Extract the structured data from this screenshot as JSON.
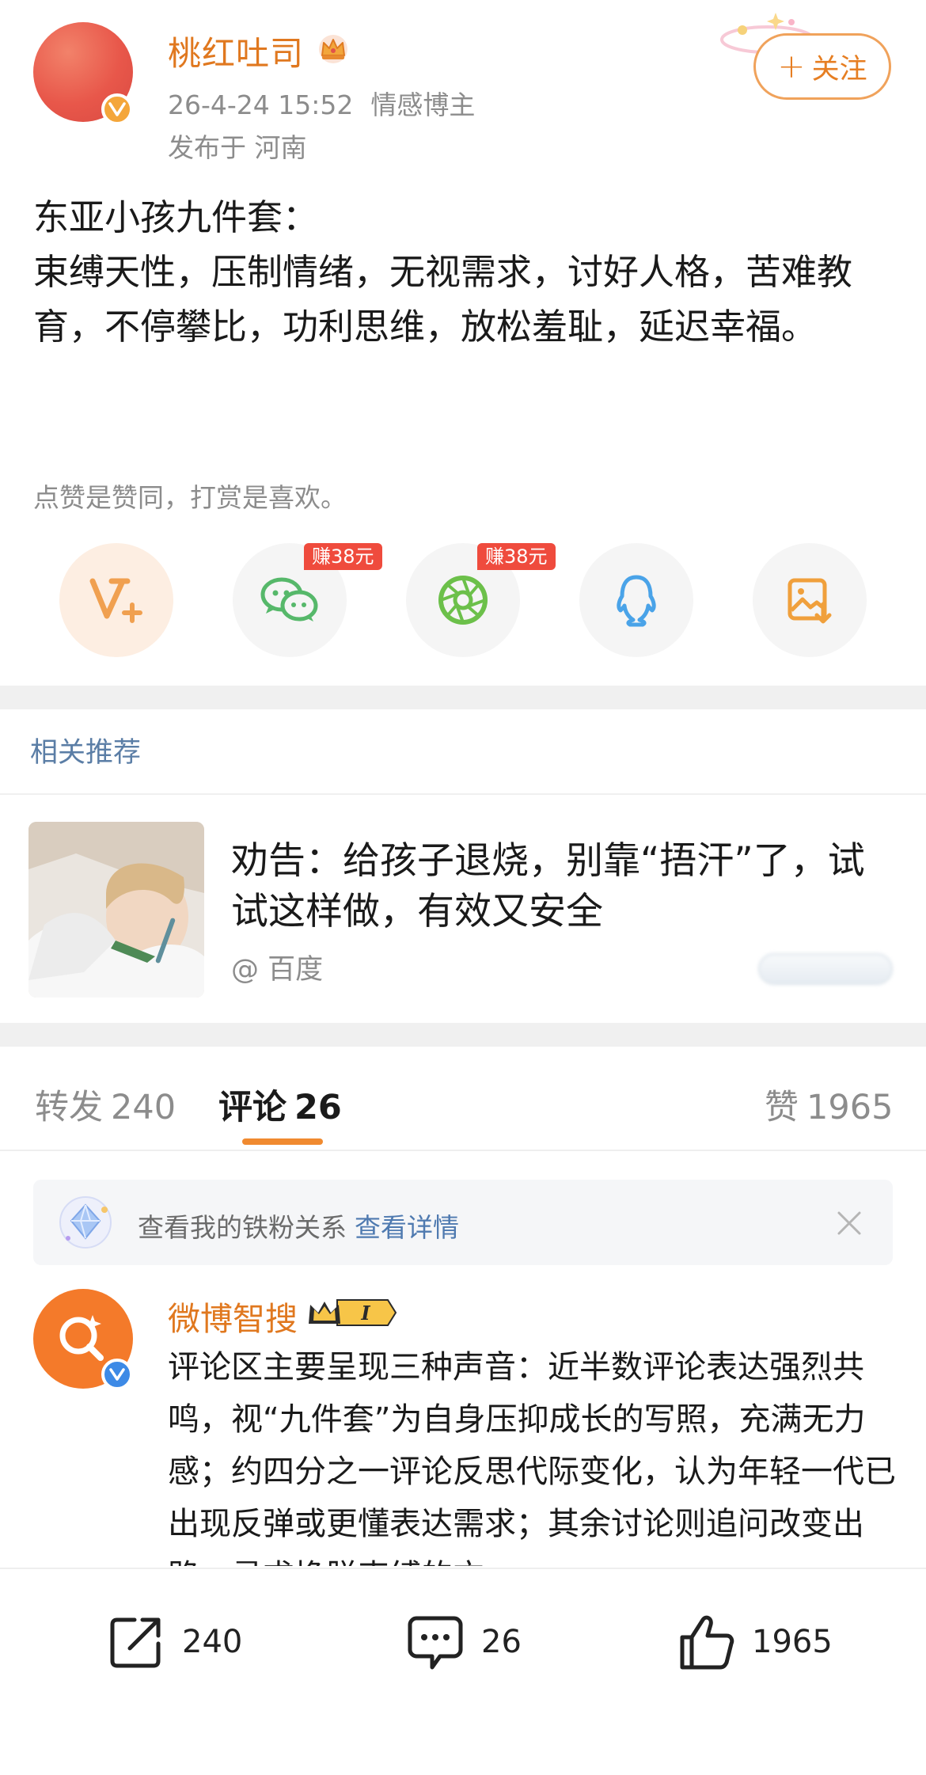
{
  "header": {
    "username": "桃红吐司",
    "timestamp": "26-4-24 15:52",
    "source_label": "情感博主",
    "location": "发布于 河南",
    "follow_label": "关注"
  },
  "post": {
    "lines": [
      "东亚小孩九件套：",
      "束缚天性，压制情绪，无视需求，讨好人格，苦难教育，不停攀比，功利思维，放松羞耻，延迟幸福。"
    ],
    "reward_note": "点赞是赞同，打赏是喜欢。"
  },
  "share": {
    "items": [
      {
        "name": "reward",
        "icon": "v-plus-icon",
        "tag": ""
      },
      {
        "name": "wechat",
        "icon": "wechat-icon",
        "tag": "赚38元"
      },
      {
        "name": "moments",
        "icon": "moments-icon",
        "tag": "赚38元"
      },
      {
        "name": "qq",
        "icon": "qq-icon",
        "tag": ""
      },
      {
        "name": "save-image",
        "icon": "save-image-icon",
        "tag": ""
      }
    ]
  },
  "recommendation": {
    "section_title": "相关推荐",
    "headline": "劝告：给孩子退烧，别靠“捂汗”了，试试这样做，有效又安全",
    "source": "@ 百度"
  },
  "tabs": {
    "repost_label": "转发",
    "repost_count": "240",
    "comment_label": "评论",
    "comment_count": "26",
    "like_label": "赞",
    "like_count": "1965",
    "active": "comment"
  },
  "fan_banner": {
    "text": "查看我的铁粉关系",
    "link": "查看详情"
  },
  "comment": {
    "author": "微博智搜",
    "level_badge": "I",
    "text": "评论区主要呈现三种声音：近半数评论表达强烈共鸣，视“九件套”为自身压抑成长的写照，充满无力感；约四分之一评论反思代际变化，认为年轻一代已出现反弹或更懂表达需求；其余讨论则追问改变出路，寻求挣脱束缚的方"
  },
  "bottom_bar": {
    "repost_count": "240",
    "comment_count": "26",
    "like_count": "1965"
  },
  "colors": {
    "accent_orange": "#e0781f",
    "link_blue": "#5b7ea6",
    "earn_red": "#ef4b3d",
    "tab_indicator": "#f08a30"
  }
}
